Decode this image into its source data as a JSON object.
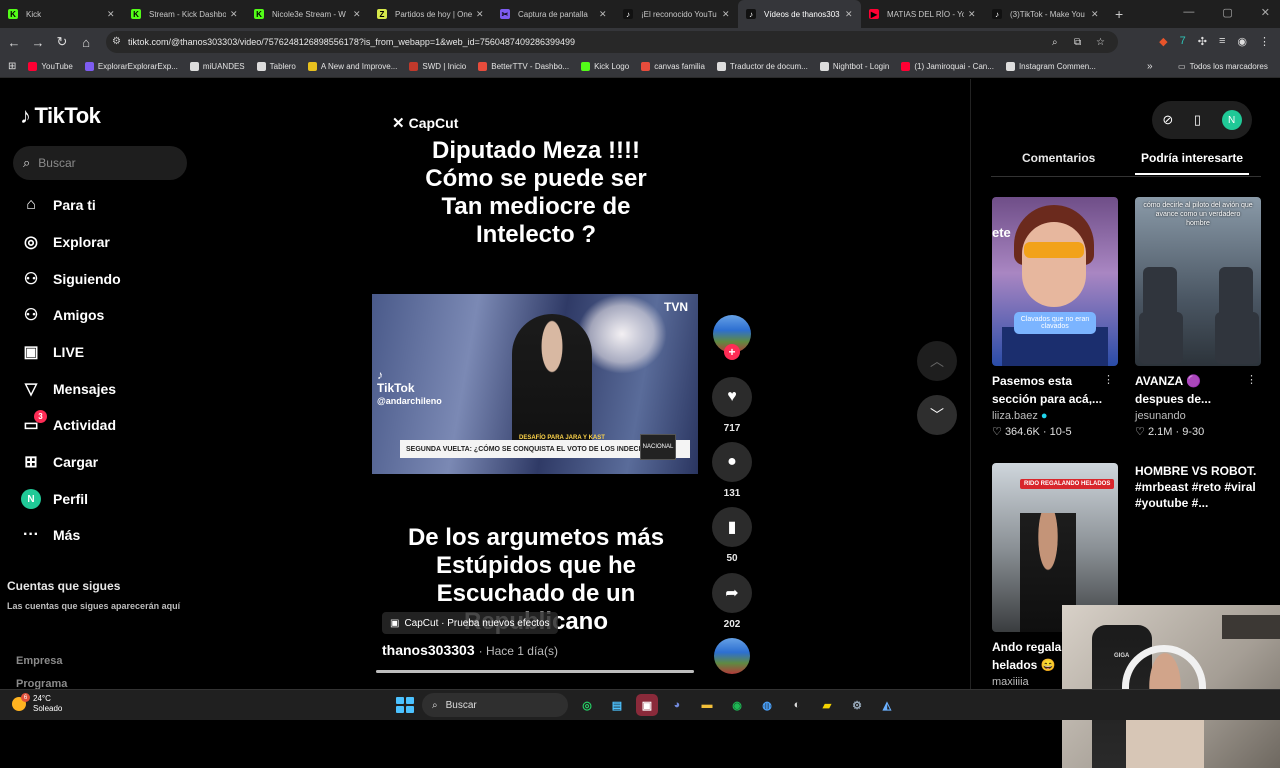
{
  "browser": {
    "tabs": [
      {
        "title": "Kick",
        "icon_color": "#53fc18",
        "icon": "K"
      },
      {
        "title": "Stream - Kick Dashbo",
        "icon_color": "#53fc18",
        "icon": "K"
      },
      {
        "title": "Nicole3e Stream - W",
        "icon_color": "#53fc18",
        "icon": "K"
      },
      {
        "title": "Partidos de hoy | One",
        "icon_color": "#d6e84a",
        "icon": "Z"
      },
      {
        "title": "Captura de pantalla",
        "icon_color": "#7d5cf0",
        "icon": "✂"
      },
      {
        "title": "¡El reconocido YouTu",
        "icon_color": "#111111",
        "icon": "♪"
      },
      {
        "title": "Vídeos de thanos303",
        "icon_color": "#111111",
        "icon": "♪",
        "active": true
      },
      {
        "title": "MATIAS DEL RÍO - Yo",
        "icon_color": "#ff0033",
        "icon": "▶"
      },
      {
        "title": "(3)TikTok - Make You",
        "icon_color": "#111111",
        "icon": "♪"
      }
    ],
    "new_tab": "+",
    "url": "tiktok.com/@thanos303303/video/7576248126898556178?is_from_webapp=1&web_id=7560487409286399499",
    "bookmarks": [
      {
        "label": "YouTube",
        "color": "#ff0033"
      },
      {
        "label": "ExplorarExplorarExp...",
        "color": "#7d5cf0"
      },
      {
        "label": "miUANDES",
        "color": "#dddddd"
      },
      {
        "label": "Tablero",
        "color": "#dddddd"
      },
      {
        "label": "A New and Improve...",
        "color": "#e8c11e"
      },
      {
        "label": "SWD | Inicio",
        "color": "#c0392b"
      },
      {
        "label": "BetterTTV - Dashbo...",
        "color": "#e74c3c"
      },
      {
        "label": "Kick Logo",
        "color": "#53fc18"
      },
      {
        "label": "canvas familia",
        "color": "#e74c3c"
      },
      {
        "label": "Traductor de docum...",
        "color": "#dddddd"
      },
      {
        "label": "Nightbot - Login",
        "color": "#dddddd"
      },
      {
        "label": "(1) Jamiroquai - Can...",
        "color": "#ff0033"
      },
      {
        "label": "Instagram Commen...",
        "color": "#dddddd"
      }
    ],
    "bookmarks_more": "»",
    "all_bookmarks": "Todos los marcadores"
  },
  "sidebar": {
    "logo": "TikTok",
    "search_placeholder": "Buscar",
    "nav": [
      {
        "label": "Para ti",
        "icon": "⌂",
        "name": "nav-para-ti"
      },
      {
        "label": "Explorar",
        "icon": "◎",
        "name": "nav-explorar"
      },
      {
        "label": "Siguiendo",
        "icon": "⚇",
        "name": "nav-siguiendo"
      },
      {
        "label": "Amigos",
        "icon": "⚇",
        "name": "nav-amigos"
      },
      {
        "label": "LIVE",
        "icon": "▣",
        "name": "nav-live"
      },
      {
        "label": "Mensajes",
        "icon": "▽",
        "name": "nav-mensajes"
      },
      {
        "label": "Actividad",
        "icon": "▭",
        "name": "nav-actividad",
        "badge": "3"
      },
      {
        "label": "Cargar",
        "icon": "⊞",
        "name": "nav-cargar"
      },
      {
        "label": "Perfil",
        "icon": "N",
        "name": "nav-perfil"
      },
      {
        "label": "Más",
        "icon": "···",
        "name": "nav-mas"
      }
    ],
    "following_title": "Cuentas que sigues",
    "following_desc": "Las cuentas que sigues aparecerán aquí",
    "footer_1": "Empresa",
    "footer_2": "Programa"
  },
  "video": {
    "capcut_logo": "CapCut",
    "top_caption": [
      "Diputado Meza !!!!",
      "Cómo se puede ser",
      "Tan mediocre de",
      "Intelecto ?"
    ],
    "clip_channel": "TVN",
    "clip_watermark": "TikTok",
    "clip_watermark_user": "@andarchileno",
    "clip_ticker_top": "DESAFÍO PARA JARA Y KAST",
    "clip_ticker": "SEGUNDA VUELTA: ¿CÓMO SE CONQUISTA EL VOTO DE LOS INDECISOS?",
    "clip_ticker_logo": "NACIONAL",
    "bottom_caption": [
      "De los argumetos más",
      "Estúpidos que he",
      "Escuchado  de un",
      "Republicano"
    ],
    "effect_pill": "CapCut · Prueba nuevos efectos",
    "author": "thanos303303",
    "time": "· Hace 1 día(s)",
    "progress": 1.0
  },
  "actions": {
    "likes": "717",
    "comments": "131",
    "saves": "50",
    "shares": "202"
  },
  "right_panel": {
    "tab_comments": "Comentarios",
    "tab_suggested": "Podría interesarte",
    "cards": [
      {
        "title_line1": "Pasemos esta",
        "title_line2": "sección para acá,...",
        "author": "liiza.baez",
        "likes": "364.6K",
        "date": "10-5",
        "thumb_caption": "Clavados que no eran clavados",
        "thumb_side": "ete"
      },
      {
        "title_line1": "AVANZA 🟣",
        "title_line2": "despues de...",
        "author": "jesunando",
        "likes": "2.1M",
        "date": "9-30",
        "thumb_caption": "cómo decirle al piloto del avión que avance como un verdadero hombre"
      },
      {
        "title_line1": "Ando regala",
        "title_line2": "helados 😄",
        "author": "maxiiiia",
        "thumb_caption": "RIDO REGALANDO HELADOS"
      },
      {
        "alt_text": "HOMBRE VS ROBOT. #mrbeast #reto #viral #youtube #..."
      }
    ]
  },
  "webcam": {
    "chair_brand": "GIGA"
  },
  "taskbar": {
    "temp": "24°C",
    "weather": "Soleado",
    "weather_badge": "6",
    "search": "Buscar"
  }
}
